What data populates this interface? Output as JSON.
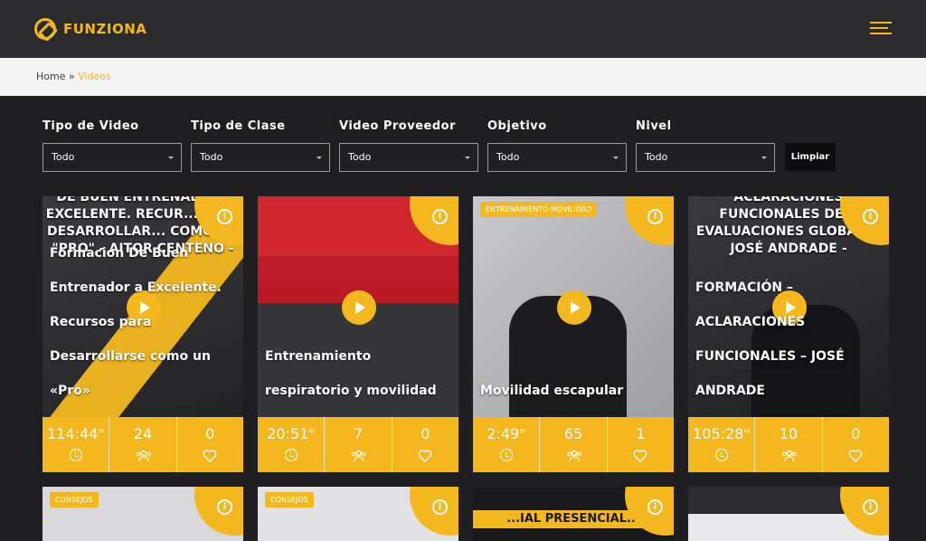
{
  "header": {
    "brand": "FUNZIONA"
  },
  "breadcrumb": {
    "home": "Home",
    "separator": "»",
    "current": "Videos"
  },
  "filters": [
    {
      "label": "Tipo de Video",
      "value": "Todo"
    },
    {
      "label": "Tipo de Clase",
      "value": "Todo"
    },
    {
      "label": "Video Proveedor",
      "value": "Todo"
    },
    {
      "label": "Objetivo",
      "value": "Todo"
    },
    {
      "label": "Nivel",
      "value": "Todo"
    }
  ],
  "clear_label": "Limpiar",
  "colors": {
    "accent": "#f4b81e",
    "background": "#1f1f22",
    "header": "#2b2b2e"
  },
  "cards": [
    {
      "banner": "DE BUEN ENTRENAD... A EXCELENTE. RECUR... PARA DESARROLLAR... COMO UN \"PRO\" - AITOR CENTENO -",
      "title": "Formación De Buen Entrenador a Excelente. Recursos para Desarrollarse como un «Pro»",
      "category": "",
      "duration": "114:44",
      "duration_unit": "m",
      "views": "24",
      "likes": "0"
    },
    {
      "banner": "",
      "title": "Entrenamiento respiratorio y movilidad",
      "category": "",
      "duration": "20:51",
      "duration_unit": "m",
      "views": "7",
      "likes": "0"
    },
    {
      "banner": "",
      "title": "Movilidad escapular",
      "category": "ENTRENAMIENTO MOVILIDAD",
      "duration": "2:49",
      "duration_unit": "m",
      "views": "65",
      "likes": "1"
    },
    {
      "banner": "ACLARACIONES FUNCIONALES DE... EVALUACIONES GLOBA... - JOSÉ ANDRADE -",
      "title": "FORMACIÓN – ACLARACIONES FUNCIONALES – JOSÉ ANDRADE",
      "category": "",
      "duration": "105:28",
      "duration_unit": "m",
      "views": "10",
      "likes": "0"
    }
  ],
  "cards_row2": [
    {
      "category": "CONSEJOS",
      "banner": ""
    },
    {
      "category": "CONSEJOS",
      "banner": ""
    },
    {
      "category": "",
      "banner": "...IAL PRESENCIAL..."
    },
    {
      "category": "",
      "banner": ""
    }
  ]
}
